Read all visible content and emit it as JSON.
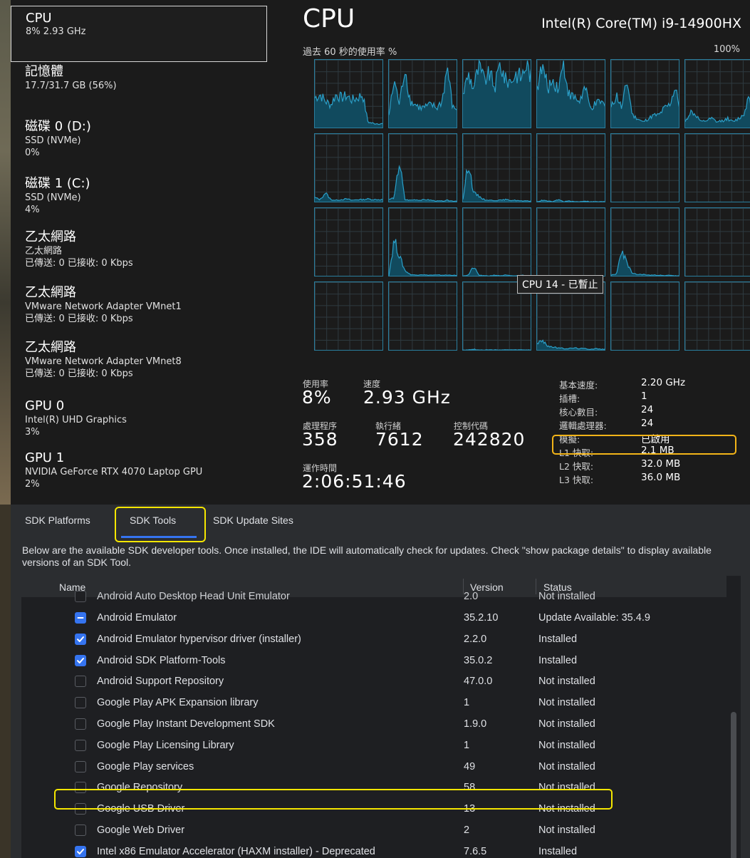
{
  "taskmgr": {
    "sidebar": [
      {
        "title": "CPU",
        "lines": [
          "8%  2.93 GHz"
        ]
      },
      {
        "title": "記憶體",
        "lines": [
          "17.7/31.7 GB (56%)"
        ]
      },
      {
        "title": "磁碟 0 (D:)",
        "lines": [
          "SSD (NVMe)",
          "0%"
        ]
      },
      {
        "title": "磁碟 1 (C:)",
        "lines": [
          "SSD (NVMe)",
          "4%"
        ]
      },
      {
        "title": "乙太網路",
        "lines": [
          "乙太網路",
          "已傳送: 0 已接收: 0 Kbps"
        ]
      },
      {
        "title": "乙太網路",
        "lines": [
          "VMware Network Adapter VMnet1",
          "已傳送: 0 已接收: 0 Kbps"
        ]
      },
      {
        "title": "乙太網路",
        "lines": [
          "VMware Network Adapter VMnet8",
          "已傳送: 0 已接收: 0 Kbps"
        ]
      },
      {
        "title": "GPU 0",
        "lines": [
          "Intel(R) UHD Graphics",
          "3%"
        ]
      },
      {
        "title": "GPU 1",
        "lines": [
          "NVIDIA GeForce RTX 4070 Laptop GPU",
          "2%"
        ]
      }
    ],
    "title": "CPU",
    "model": "Intel(R) Core(TM) i9-14900HX",
    "usage_label": "過去 60 秒的使用率 %",
    "usage_max": "100%",
    "tooltip": "CPU 14 - 已暫止",
    "stats": {
      "usage_label": "使用率",
      "usage_value": "8%",
      "speed_label": "速度",
      "speed_value": "2.93 GHz",
      "processes_label": "處理程序",
      "processes_value": "358",
      "threads_label": "執行緒",
      "threads_value": "7612",
      "handles_label": "控制代碼",
      "handles_value": "242820",
      "uptime_label": "運作時間",
      "uptime_value": "2:06:51:46"
    },
    "specs": [
      {
        "label": "基本速度:",
        "value": "2.20 GHz"
      },
      {
        "label": "插槽:",
        "value": "1"
      },
      {
        "label": "核心數目:",
        "value": "24"
      },
      {
        "label": "邏輯處理器:",
        "value": "24"
      },
      {
        "label": "模擬:",
        "value": "已啟用"
      },
      {
        "label": "L1 快取:",
        "value": "2.1 MB"
      },
      {
        "label": "L2 快取:",
        "value": "32.0 MB"
      },
      {
        "label": "L3 快取:",
        "value": "36.0 MB"
      }
    ],
    "colors": {
      "graph_line": "#2a9fc8",
      "graph_fill": "#114a5e",
      "highlight": "#f3b418"
    }
  },
  "sdk": {
    "tabs": [
      "SDK Platforms",
      "SDK Tools",
      "SDK Update Sites"
    ],
    "description": "Below are the available SDK developer tools. Once installed, the IDE will automatically check for updates. Check \"show package details\" to display available versions of an SDK Tool.",
    "columns": {
      "name": "Name",
      "version": "Version",
      "status": "Status"
    },
    "rows": [
      {
        "name": "Android Auto Desktop Head Unit Emulator",
        "version": "2.0",
        "status": "Not installed",
        "state": "unchecked"
      },
      {
        "name": "Android Emulator",
        "version": "35.2.10",
        "status": "Update Available: 35.4.9",
        "state": "partial"
      },
      {
        "name": "Android Emulator hypervisor driver (installer)",
        "version": "2.2.0",
        "status": "Installed",
        "state": "checked"
      },
      {
        "name": "Android SDK Platform-Tools",
        "version": "35.0.2",
        "status": "Installed",
        "state": "checked"
      },
      {
        "name": "Android Support Repository",
        "version": "47.0.0",
        "status": "Not installed",
        "state": "unchecked"
      },
      {
        "name": "Google Play APK Expansion library",
        "version": "1",
        "status": "Not installed",
        "state": "unchecked"
      },
      {
        "name": "Google Play Instant Development SDK",
        "version": "1.9.0",
        "status": "Not installed",
        "state": "unchecked"
      },
      {
        "name": "Google Play Licensing Library",
        "version": "1",
        "status": "Not installed",
        "state": "unchecked"
      },
      {
        "name": "Google Play services",
        "version": "49",
        "status": "Not installed",
        "state": "unchecked"
      },
      {
        "name": "Google Repository",
        "version": "58",
        "status": "Not installed",
        "state": "unchecked"
      },
      {
        "name": "Google USB Driver",
        "version": "13",
        "status": "Not installed",
        "state": "unchecked"
      },
      {
        "name": "Google Web Driver",
        "version": "2",
        "status": "Not installed",
        "state": "unchecked"
      },
      {
        "name": "Intel x86 Emulator Accelerator (HAXM installer) - Deprecated",
        "version": "7.6.5",
        "status": "Installed",
        "state": "checked"
      }
    ],
    "colors": {
      "accent": "#3574f0",
      "highlight": "#f5e600"
    }
  }
}
